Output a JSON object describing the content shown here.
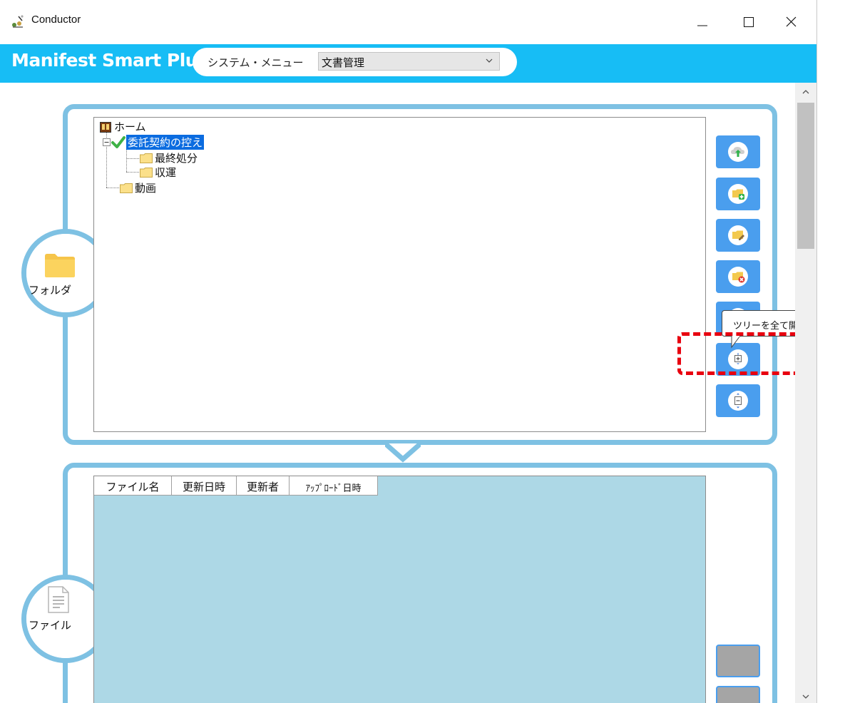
{
  "window": {
    "title": "Conductor",
    "controls": [
      "minimize",
      "maximize",
      "close"
    ]
  },
  "header": {
    "brand": "Manifest Smart Plus",
    "menu_label": "システム・メニュー",
    "menu_selected": "文書管理",
    "bg_color": "#17bdf5"
  },
  "folder_panel": {
    "label": "フォルダ",
    "icon": "folder-icon",
    "tree": [
      {
        "label": "ホーム",
        "icon": "home-book-icon",
        "level": 0
      },
      {
        "label": "委託契約の控え",
        "icon": "check-icon",
        "level": 1,
        "selected": true
      },
      {
        "label": "最終処分",
        "icon": "folder-icon",
        "level": 2
      },
      {
        "label": "収運",
        "icon": "folder-icon",
        "level": 2
      },
      {
        "label": "動画",
        "icon": "folder-icon",
        "level": 1
      }
    ],
    "buttons": [
      {
        "name": "upload-button",
        "icon": "cloud-upload-icon"
      },
      {
        "name": "add-folder-button",
        "icon": "folder-add-icon"
      },
      {
        "name": "edit-folder-button",
        "icon": "folder-edit-icon"
      },
      {
        "name": "delete-folder-button",
        "icon": "folder-delete-icon"
      },
      {
        "name": "hidden-button",
        "icon": "folder-icon"
      },
      {
        "name": "expand-all-button",
        "icon": "tree-expand-icon"
      },
      {
        "name": "collapse-all-button",
        "icon": "tree-collapse-icon"
      }
    ],
    "tooltip": "ツリーを全て開く"
  },
  "file_panel": {
    "label": "ファイル",
    "icon": "document-icon",
    "columns": [
      "ファイル名",
      "更新日時",
      "更新者",
      "ｱｯﾌﾟﾛｰﾄﾞ日時"
    ],
    "list_bg": "#add8e6"
  },
  "colors": {
    "frame": "#7ec1e3",
    "button": "#4a9eee",
    "highlight": "#e8000f"
  }
}
